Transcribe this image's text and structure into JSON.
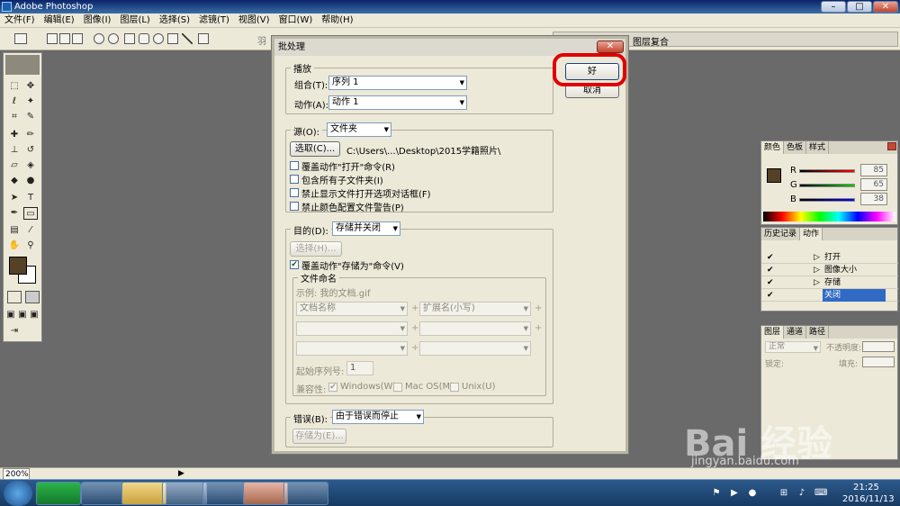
{
  "app_title": "Adobe Photoshop",
  "window_buttons": {
    "minimize": "–",
    "maximize": "□",
    "close": "✕"
  },
  "menu": [
    "文件(F)",
    "编辑(E)",
    "图像(I)",
    "图层(L)",
    "选择(S)",
    "滤镜(T)",
    "视图(V)",
    "窗口(W)",
    "帮助(H)"
  ],
  "optbar": {
    "feather_label": "羽",
    "palette_well": "图层复合"
  },
  "dialog": {
    "title": "批处理",
    "close": "✕",
    "ok_label": "好",
    "cancel_label": "取消",
    "play": {
      "group_label": "播放",
      "set_label": "组合(T):",
      "set_value": "序列 1",
      "action_label": "动作(A):",
      "action_value": "动作 1"
    },
    "source": {
      "label": "源(O):",
      "value": "文件夹",
      "choose_label": "选取(C)...",
      "path": "C:\\Users\\...\\Desktop\\2015学籍照片\\",
      "checks": [
        {
          "label": "覆盖动作\"打开\"命令(R)",
          "checked": false
        },
        {
          "label": "包含所有子文件夹(I)",
          "checked": false
        },
        {
          "label": "禁止显示文件打开选项对话框(F)",
          "checked": false
        },
        {
          "label": "禁止颜色配置文件警告(P)",
          "checked": false
        }
      ]
    },
    "destination": {
      "label": "目的(D):",
      "value": "存储并关闭",
      "choose_label": "选择(H)...",
      "override_label": "覆盖动作\"存储为\"命令(V)",
      "override_checked": true,
      "naming": {
        "group_label": "文件命名",
        "example": "示例: 我的文档.gif",
        "field1": "文档名称",
        "field2": "扩展名(小写)",
        "start_serial_label": "起始序列号:",
        "start_serial_value": "1",
        "compat_label": "兼容性:",
        "compat": [
          {
            "label": "Windows(W)",
            "checked": true
          },
          {
            "label": "Mac OS(M)",
            "checked": false
          },
          {
            "label": "Unix(U)",
            "checked": false
          }
        ]
      }
    },
    "errors": {
      "label": "错误(B):",
      "value": "由于错误而停止",
      "save_as_label": "存储为(E)..."
    }
  },
  "color_panel": {
    "tabs": [
      "颜色",
      "色板",
      "样式"
    ],
    "r_label": "R",
    "r_value": "85",
    "g_label": "G",
    "g_value": "65",
    "b_label": "B",
    "b_value": "38",
    "foreground_color": "#554126"
  },
  "history_panel": {
    "tabs": [
      "历史记录",
      "动作"
    ],
    "rows": [
      "打开",
      "图像大小",
      "存储",
      "关闭"
    ]
  },
  "layers_panel": {
    "tabs": [
      "图层",
      "通道",
      "路径"
    ],
    "blend_mode": "正常",
    "opacity_label": "不透明度:",
    "lock_label": "锁定:",
    "fill_label": "填充:"
  },
  "status": {
    "zoom": "200%"
  },
  "clock": {
    "time": "21:25",
    "date": "2016/11/13"
  },
  "watermark": {
    "brand": "Bai 经验",
    "url": "jingyan.baidu.com"
  }
}
